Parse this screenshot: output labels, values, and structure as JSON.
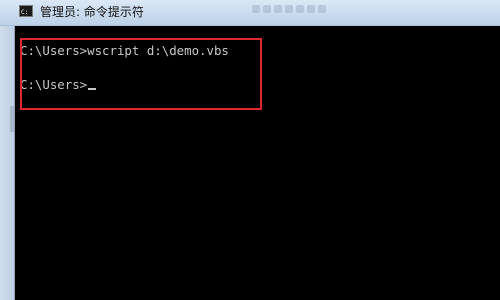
{
  "window": {
    "title": "管理员: 命令提示符",
    "icon": "cmd-icon"
  },
  "console": {
    "lines": [
      {
        "text": "C:\\Users>wscript d:\\demo.vbs"
      },
      {
        "text": "C:\\Users>"
      }
    ],
    "text_color": "#c8c8c8",
    "background": "#000000"
  },
  "annotation": {
    "highlight_color": "#e0262f"
  }
}
